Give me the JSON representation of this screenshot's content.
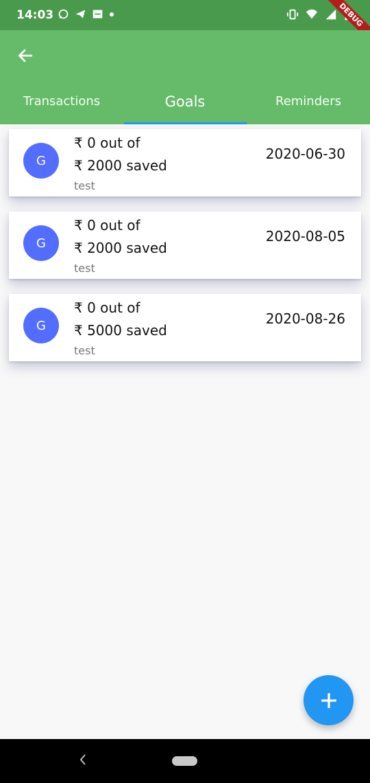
{
  "status_bar": {
    "time": "14:03",
    "debug_label": "DEBUG"
  },
  "app_bar": {
    "tabs": [
      {
        "label": "Transactions"
      },
      {
        "label": "Goals"
      },
      {
        "label": "Reminders"
      }
    ]
  },
  "goals": [
    {
      "avatar": "G",
      "amount_line": "₹ 0 out of",
      "target_line": "₹ 2000 saved",
      "note": "test",
      "date": "2020-06-30"
    },
    {
      "avatar": "G",
      "amount_line": "₹ 0 out of",
      "target_line": "₹ 2000 saved",
      "note": "test",
      "date": "2020-08-05"
    },
    {
      "avatar": "G",
      "amount_line": "₹ 0 out of",
      "target_line": "₹ 5000 saved",
      "note": "test",
      "date": "2020-08-26"
    }
  ],
  "fab": {
    "icon": "plus-icon"
  },
  "theme": {
    "appbar_color": "#66bb6a",
    "status_color": "#4a9a4e",
    "accent_color": "#2196f3",
    "avatar_color": "#536dfe"
  }
}
